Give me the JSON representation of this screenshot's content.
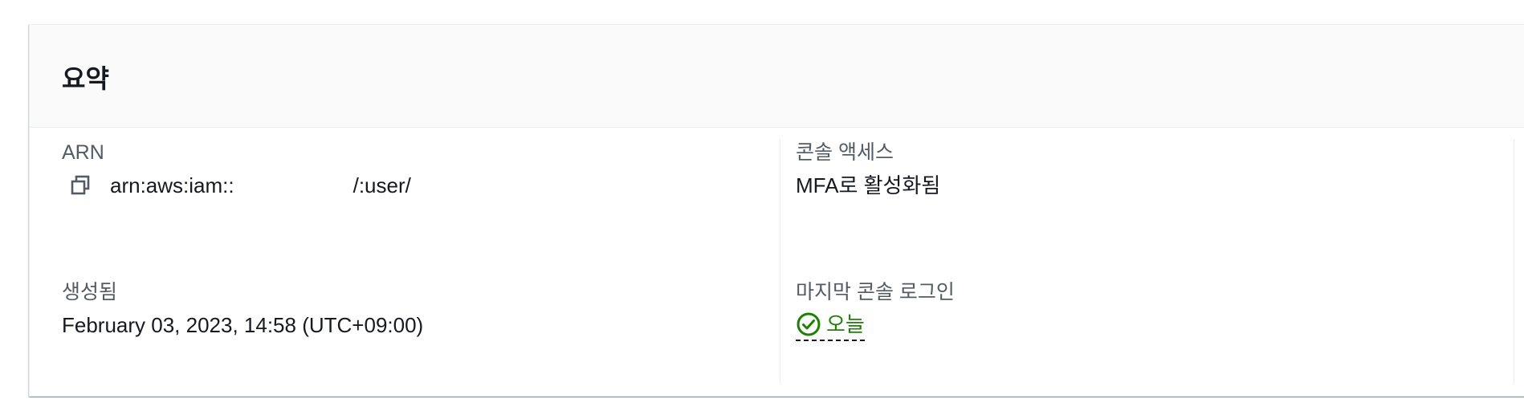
{
  "summary": {
    "title": "요약"
  },
  "fields": {
    "arn": {
      "label": "ARN",
      "value_prefix": "arn:aws:iam::",
      "value_middle": "/:user/"
    },
    "console_access": {
      "label": "콘솔 액세스",
      "value": "MFA로 활성화됨"
    },
    "created": {
      "label": "생성됨",
      "value": "February 03, 2023, 14:58 (UTC+09:00)"
    },
    "last_console_login": {
      "label": "마지막 콘솔 로그인",
      "value": "오늘",
      "status_color": "#1d8102"
    }
  },
  "icons": {
    "copy": "copy-icon",
    "status": "check-circle-icon"
  }
}
